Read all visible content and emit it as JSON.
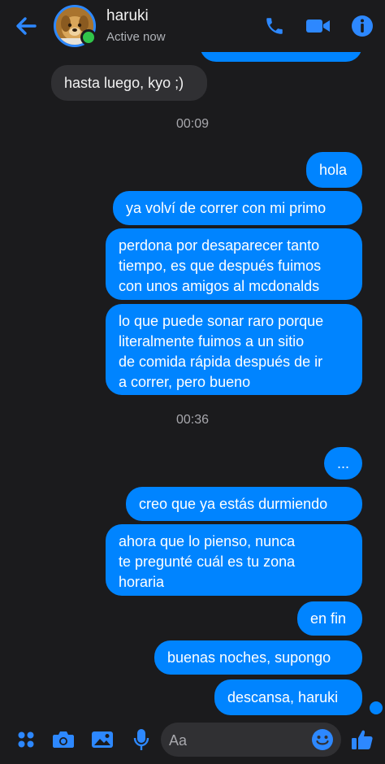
{
  "header": {
    "contact_name": "haruki",
    "status": "Active now"
  },
  "messages": {
    "m0": {
      "text": "",
      "from": "me"
    },
    "m1": {
      "text": "hasta luego, kyo ;)",
      "from": "them"
    },
    "time1": "00:09",
    "m2": {
      "text": "hola",
      "from": "me"
    },
    "m3": {
      "text": "ya volví de correr con mi primo",
      "from": "me"
    },
    "m4": {
      "text": "perdona por desaparecer tanto\ntiempo, es que después fuimos\ncon unos amigos al mcdonalds",
      "from": "me"
    },
    "m5": {
      "text": "lo que puede sonar raro porque\nliteralmente fuimos a un sitio\nde comida rápida después de ir\na correr, pero bueno",
      "from": "me"
    },
    "time2": "00:36",
    "m6": {
      "text": "...",
      "from": "me"
    },
    "m7": {
      "text": "creo que ya estás durmiendo",
      "from": "me"
    },
    "m8": {
      "text": "ahora que lo pienso, nunca\nte pregunté cuál es tu zona\nhoraria",
      "from": "me"
    },
    "m9": {
      "text": "en fin",
      "from": "me"
    },
    "m10": {
      "text": "buenas noches, supongo",
      "from": "me"
    },
    "m11": {
      "text": "descansa, haruki",
      "from": "me"
    }
  },
  "composer": {
    "placeholder": "Aa"
  },
  "colors": {
    "background": "#1b1b1d",
    "accent": "#0084ff",
    "incoming_bubble": "#303033",
    "online": "#31c54a"
  },
  "icons": [
    "back-arrow-icon",
    "phone-icon",
    "video-camera-icon",
    "info-icon",
    "apps-icon",
    "camera-icon",
    "image-icon",
    "microphone-icon",
    "emoji-icon",
    "thumbs-up-icon"
  ]
}
